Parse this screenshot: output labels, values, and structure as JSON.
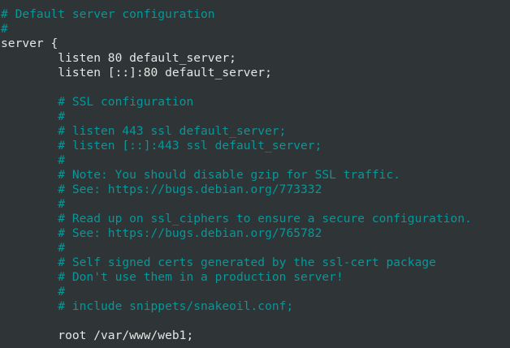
{
  "editor": {
    "colors": {
      "background": "#2f3436",
      "text": "#e4e7e3",
      "comment": "#06989a"
    },
    "lines": [
      {
        "text": "# Default server configuration",
        "kind": "comment"
      },
      {
        "text": "#",
        "kind": "comment"
      },
      {
        "text": "server {",
        "kind": "code"
      },
      {
        "text": "        listen 80 default_server;",
        "kind": "code"
      },
      {
        "text": "        listen [::]:80 default_server;",
        "kind": "code"
      },
      {
        "text": "",
        "kind": "blank"
      },
      {
        "text": "        # SSL configuration",
        "kind": "comment"
      },
      {
        "text": "        #",
        "kind": "comment"
      },
      {
        "text": "        # listen 443 ssl default_server;",
        "kind": "comment"
      },
      {
        "text": "        # listen [::]:443 ssl default_server;",
        "kind": "comment"
      },
      {
        "text": "        #",
        "kind": "comment"
      },
      {
        "text": "        # Note: You should disable gzip for SSL traffic.",
        "kind": "comment"
      },
      {
        "text": "        # See: https://bugs.debian.org/773332",
        "kind": "comment"
      },
      {
        "text": "        #",
        "kind": "comment"
      },
      {
        "text": "        # Read up on ssl_ciphers to ensure a secure configuration.",
        "kind": "comment"
      },
      {
        "text": "        # See: https://bugs.debian.org/765782",
        "kind": "comment"
      },
      {
        "text": "        #",
        "kind": "comment"
      },
      {
        "text": "        # Self signed certs generated by the ssl-cert package",
        "kind": "comment"
      },
      {
        "text": "        # Don't use them in a production server!",
        "kind": "comment"
      },
      {
        "text": "        #",
        "kind": "comment"
      },
      {
        "text": "        # include snippets/snakeoil.conf;",
        "kind": "comment"
      },
      {
        "text": "",
        "kind": "blank"
      },
      {
        "text": "        root /var/www/web1;",
        "kind": "code"
      }
    ]
  }
}
